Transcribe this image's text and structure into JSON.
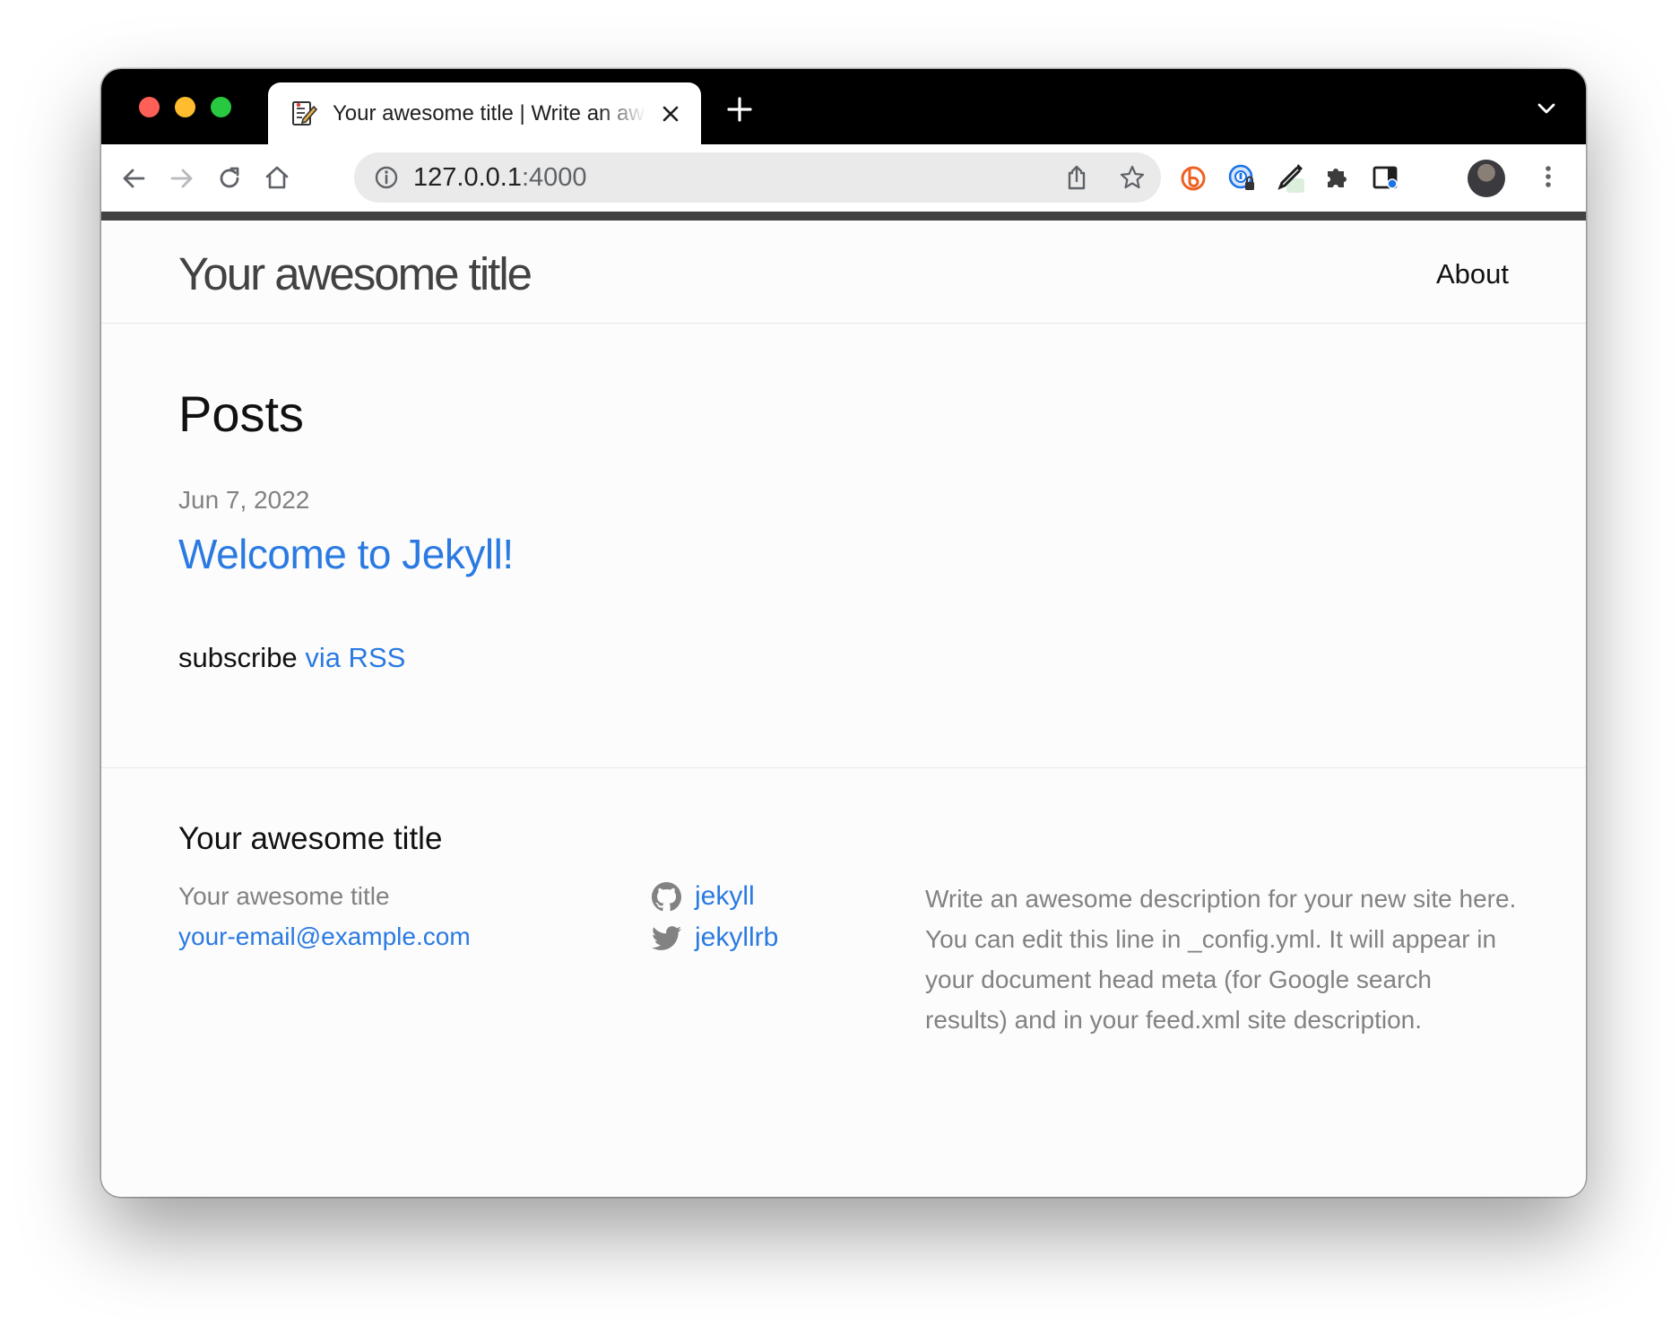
{
  "browser": {
    "tab": {
      "title": "Your awesome title | Write an awesome description for your new site here."
    },
    "address_bar": {
      "host": "127.0.0.1",
      "port": ":4000"
    }
  },
  "site": {
    "title": "Your awesome title",
    "nav": [
      {
        "label": "About"
      }
    ]
  },
  "main": {
    "heading": "Posts",
    "posts": [
      {
        "date": "Jun 7, 2022",
        "title": "Welcome to Jekyll!"
      }
    ],
    "subscribe_text": "subscribe",
    "subscribe_link": "via RSS"
  },
  "footer": {
    "heading": "Your awesome title",
    "name": "Your awesome title",
    "email": "your-email@example.com",
    "social": [
      {
        "label": "jekyll",
        "icon": "github-icon"
      },
      {
        "label": "jekyllrb",
        "icon": "twitter-icon"
      }
    ],
    "description": "Write an awesome description for your new site here. You can edit this line in _config.yml. It will appear in your document head meta (for Google search results) and in your feed.xml site description."
  },
  "colors": {
    "link": "#2a7ae2",
    "muted": "#828282",
    "text": "#111111",
    "chrome_dark": "#000000"
  }
}
